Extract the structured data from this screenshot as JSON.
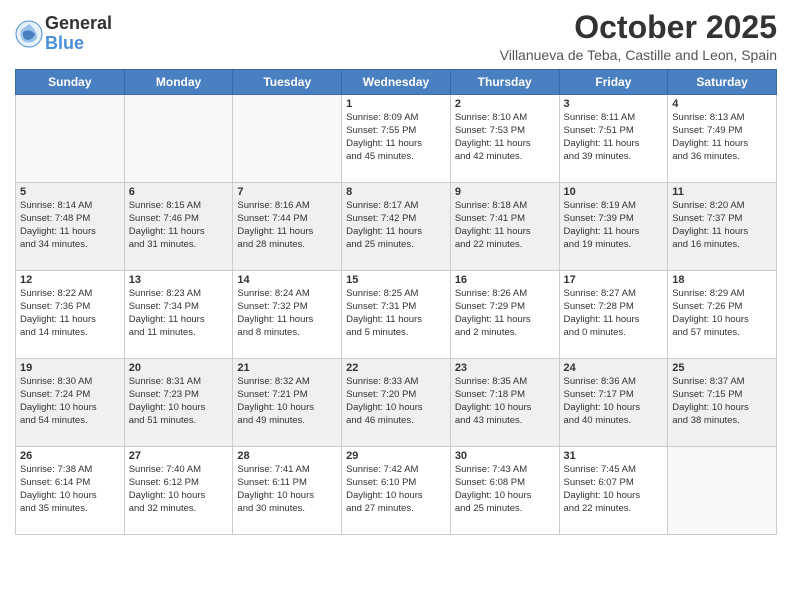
{
  "logo": {
    "general": "General",
    "blue": "Blue"
  },
  "header": {
    "title": "October 2025",
    "subtitle": "Villanueva de Teba, Castille and Leon, Spain"
  },
  "days_of_week": [
    "Sunday",
    "Monday",
    "Tuesday",
    "Wednesday",
    "Thursday",
    "Friday",
    "Saturday"
  ],
  "weeks": [
    [
      {
        "day": "",
        "info": [],
        "empty": true
      },
      {
        "day": "",
        "info": [],
        "empty": true
      },
      {
        "day": "",
        "info": [],
        "empty": true
      },
      {
        "day": "1",
        "info": [
          "Sunrise: 8:09 AM",
          "Sunset: 7:55 PM",
          "Daylight: 11 hours",
          "and 45 minutes."
        ]
      },
      {
        "day": "2",
        "info": [
          "Sunrise: 8:10 AM",
          "Sunset: 7:53 PM",
          "Daylight: 11 hours",
          "and 42 minutes."
        ]
      },
      {
        "day": "3",
        "info": [
          "Sunrise: 8:11 AM",
          "Sunset: 7:51 PM",
          "Daylight: 11 hours",
          "and 39 minutes."
        ]
      },
      {
        "day": "4",
        "info": [
          "Sunrise: 8:13 AM",
          "Sunset: 7:49 PM",
          "Daylight: 11 hours",
          "and 36 minutes."
        ]
      }
    ],
    [
      {
        "day": "5",
        "info": [
          "Sunrise: 8:14 AM",
          "Sunset: 7:48 PM",
          "Daylight: 11 hours",
          "and 34 minutes."
        ],
        "shaded": true
      },
      {
        "day": "6",
        "info": [
          "Sunrise: 8:15 AM",
          "Sunset: 7:46 PM",
          "Daylight: 11 hours",
          "and 31 minutes."
        ],
        "shaded": true
      },
      {
        "day": "7",
        "info": [
          "Sunrise: 8:16 AM",
          "Sunset: 7:44 PM",
          "Daylight: 11 hours",
          "and 28 minutes."
        ],
        "shaded": true
      },
      {
        "day": "8",
        "info": [
          "Sunrise: 8:17 AM",
          "Sunset: 7:42 PM",
          "Daylight: 11 hours",
          "and 25 minutes."
        ],
        "shaded": true
      },
      {
        "day": "9",
        "info": [
          "Sunrise: 8:18 AM",
          "Sunset: 7:41 PM",
          "Daylight: 11 hours",
          "and 22 minutes."
        ],
        "shaded": true
      },
      {
        "day": "10",
        "info": [
          "Sunrise: 8:19 AM",
          "Sunset: 7:39 PM",
          "Daylight: 11 hours",
          "and 19 minutes."
        ],
        "shaded": true
      },
      {
        "day": "11",
        "info": [
          "Sunrise: 8:20 AM",
          "Sunset: 7:37 PM",
          "Daylight: 11 hours",
          "and 16 minutes."
        ],
        "shaded": true
      }
    ],
    [
      {
        "day": "12",
        "info": [
          "Sunrise: 8:22 AM",
          "Sunset: 7:36 PM",
          "Daylight: 11 hours",
          "and 14 minutes."
        ]
      },
      {
        "day": "13",
        "info": [
          "Sunrise: 8:23 AM",
          "Sunset: 7:34 PM",
          "Daylight: 11 hours",
          "and 11 minutes."
        ]
      },
      {
        "day": "14",
        "info": [
          "Sunrise: 8:24 AM",
          "Sunset: 7:32 PM",
          "Daylight: 11 hours",
          "and 8 minutes."
        ]
      },
      {
        "day": "15",
        "info": [
          "Sunrise: 8:25 AM",
          "Sunset: 7:31 PM",
          "Daylight: 11 hours",
          "and 5 minutes."
        ]
      },
      {
        "day": "16",
        "info": [
          "Sunrise: 8:26 AM",
          "Sunset: 7:29 PM",
          "Daylight: 11 hours",
          "and 2 minutes."
        ]
      },
      {
        "day": "17",
        "info": [
          "Sunrise: 8:27 AM",
          "Sunset: 7:28 PM",
          "Daylight: 11 hours",
          "and 0 minutes."
        ]
      },
      {
        "day": "18",
        "info": [
          "Sunrise: 8:29 AM",
          "Sunset: 7:26 PM",
          "Daylight: 10 hours",
          "and 57 minutes."
        ]
      }
    ],
    [
      {
        "day": "19",
        "info": [
          "Sunrise: 8:30 AM",
          "Sunset: 7:24 PM",
          "Daylight: 10 hours",
          "and 54 minutes."
        ],
        "shaded": true
      },
      {
        "day": "20",
        "info": [
          "Sunrise: 8:31 AM",
          "Sunset: 7:23 PM",
          "Daylight: 10 hours",
          "and 51 minutes."
        ],
        "shaded": true
      },
      {
        "day": "21",
        "info": [
          "Sunrise: 8:32 AM",
          "Sunset: 7:21 PM",
          "Daylight: 10 hours",
          "and 49 minutes."
        ],
        "shaded": true
      },
      {
        "day": "22",
        "info": [
          "Sunrise: 8:33 AM",
          "Sunset: 7:20 PM",
          "Daylight: 10 hours",
          "and 46 minutes."
        ],
        "shaded": true
      },
      {
        "day": "23",
        "info": [
          "Sunrise: 8:35 AM",
          "Sunset: 7:18 PM",
          "Daylight: 10 hours",
          "and 43 minutes."
        ],
        "shaded": true
      },
      {
        "day": "24",
        "info": [
          "Sunrise: 8:36 AM",
          "Sunset: 7:17 PM",
          "Daylight: 10 hours",
          "and 40 minutes."
        ],
        "shaded": true
      },
      {
        "day": "25",
        "info": [
          "Sunrise: 8:37 AM",
          "Sunset: 7:15 PM",
          "Daylight: 10 hours",
          "and 38 minutes."
        ],
        "shaded": true
      }
    ],
    [
      {
        "day": "26",
        "info": [
          "Sunrise: 7:38 AM",
          "Sunset: 6:14 PM",
          "Daylight: 10 hours",
          "and 35 minutes."
        ]
      },
      {
        "day": "27",
        "info": [
          "Sunrise: 7:40 AM",
          "Sunset: 6:12 PM",
          "Daylight: 10 hours",
          "and 32 minutes."
        ]
      },
      {
        "day": "28",
        "info": [
          "Sunrise: 7:41 AM",
          "Sunset: 6:11 PM",
          "Daylight: 10 hours",
          "and 30 minutes."
        ]
      },
      {
        "day": "29",
        "info": [
          "Sunrise: 7:42 AM",
          "Sunset: 6:10 PM",
          "Daylight: 10 hours",
          "and 27 minutes."
        ]
      },
      {
        "day": "30",
        "info": [
          "Sunrise: 7:43 AM",
          "Sunset: 6:08 PM",
          "Daylight: 10 hours",
          "and 25 minutes."
        ]
      },
      {
        "day": "31",
        "info": [
          "Sunrise: 7:45 AM",
          "Sunset: 6:07 PM",
          "Daylight: 10 hours",
          "and 22 minutes."
        ]
      },
      {
        "day": "",
        "info": [],
        "empty": true
      }
    ]
  ]
}
